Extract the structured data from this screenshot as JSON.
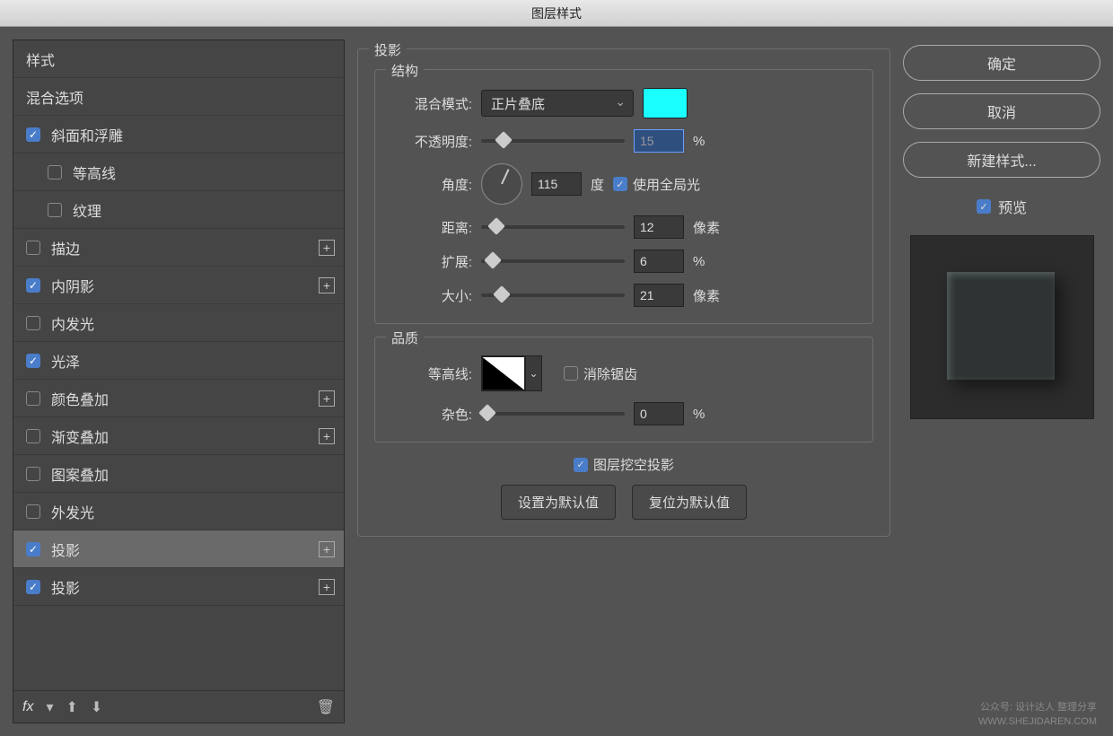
{
  "window": {
    "title": "图层样式"
  },
  "sidebar": {
    "header": "样式",
    "blend": "混合选项",
    "items": [
      {
        "label": "斜面和浮雕",
        "checked": true,
        "plus": false,
        "indent": false
      },
      {
        "label": "等高线",
        "checked": false,
        "plus": false,
        "indent": true
      },
      {
        "label": "纹理",
        "checked": false,
        "plus": false,
        "indent": true
      },
      {
        "label": "描边",
        "checked": false,
        "plus": true,
        "indent": false
      },
      {
        "label": "内阴影",
        "checked": true,
        "plus": true,
        "indent": false
      },
      {
        "label": "内发光",
        "checked": false,
        "plus": false,
        "indent": false
      },
      {
        "label": "光泽",
        "checked": true,
        "plus": false,
        "indent": false
      },
      {
        "label": "颜色叠加",
        "checked": false,
        "plus": true,
        "indent": false
      },
      {
        "label": "渐变叠加",
        "checked": false,
        "plus": true,
        "indent": false
      },
      {
        "label": "图案叠加",
        "checked": false,
        "plus": false,
        "indent": false
      },
      {
        "label": "外发光",
        "checked": false,
        "plus": false,
        "indent": false
      },
      {
        "label": "投影",
        "checked": true,
        "plus": true,
        "indent": false,
        "selected": true
      },
      {
        "label": "投影",
        "checked": true,
        "plus": true,
        "indent": false
      }
    ],
    "fx": "fx"
  },
  "panel": {
    "title": "投影",
    "structure": {
      "legend": "结构",
      "blendModeLabel": "混合模式:",
      "blendModeValue": "正片叠底",
      "swatchColor": "#1affff",
      "opacityLabel": "不透明度:",
      "opacityValue": "15",
      "opacityUnit": "%",
      "angleLabel": "角度:",
      "angleValue": "115",
      "angleUnit": "度",
      "globalLight": "使用全局光",
      "globalLightChecked": true,
      "distanceLabel": "距离:",
      "distanceValue": "12",
      "distanceUnit": "像素",
      "spreadLabel": "扩展:",
      "spreadValue": "6",
      "spreadUnit": "%",
      "sizeLabel": "大小:",
      "sizeValue": "21",
      "sizeUnit": "像素"
    },
    "quality": {
      "legend": "品质",
      "contourLabel": "等高线:",
      "antiAlias": "消除锯齿",
      "antiAliasChecked": false,
      "noiseLabel": "杂色:",
      "noiseValue": "0",
      "noiseUnit": "%"
    },
    "knockout": {
      "label": "图层挖空投影",
      "checked": true
    },
    "setDefault": "设置为默认值",
    "resetDefault": "复位为默认值"
  },
  "right": {
    "ok": "确定",
    "cancel": "取消",
    "newStyle": "新建样式...",
    "preview": "预览"
  },
  "watermark": {
    "line1": "公众号: 设计达人 整理分享",
    "line2": "WWW.SHEJIDAREN.COM"
  }
}
